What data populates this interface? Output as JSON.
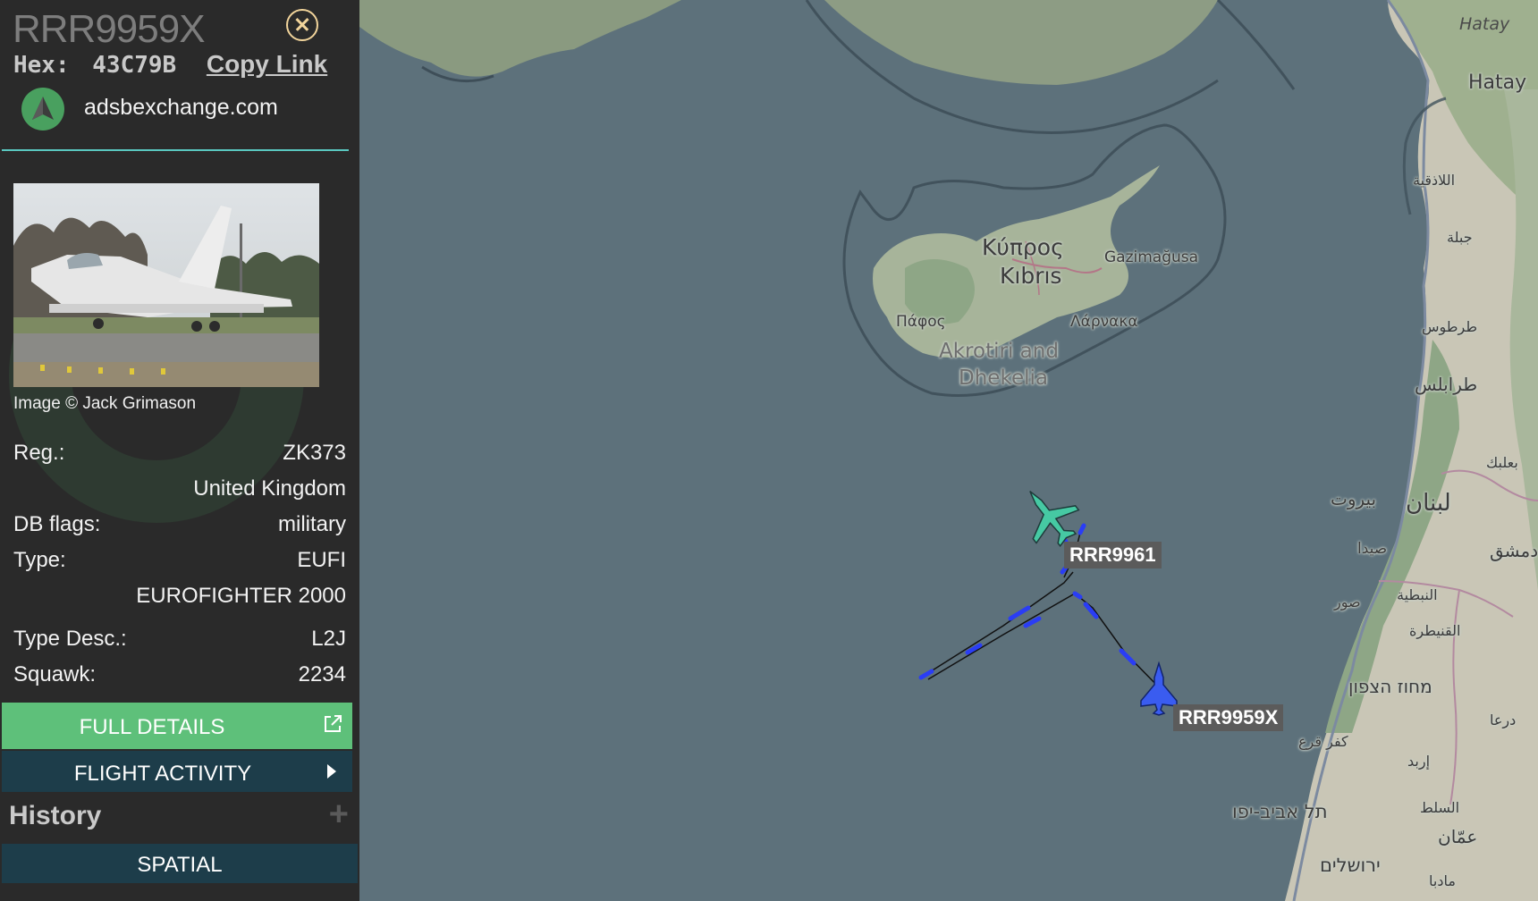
{
  "aircraft": {
    "callsign": "RRR9959X",
    "hex_label": "Hex:",
    "hex": "43C79B",
    "copy_link": "Copy Link",
    "source_site": "adsbexchange.com",
    "photo_credit": "Image © Jack Grimason",
    "fields": [
      {
        "label": "Reg.:",
        "value": "ZK373"
      },
      {
        "label": "",
        "value": "United Kingdom"
      },
      {
        "label": "DB flags:",
        "value": "military"
      },
      {
        "label": "Type:",
        "value": "EUFI"
      },
      {
        "label": "",
        "value": "EUROFIGHTER 2000"
      },
      {
        "label": "Type Desc.:",
        "value": "L2J"
      },
      {
        "label": "Squawk:",
        "value": "2234"
      }
    ]
  },
  "buttons": {
    "full_details": "FULL DETAILS",
    "flight_activity": "FLIGHT ACTIVITY",
    "history": "History",
    "history_expand": "+",
    "spatial": "SPATIAL"
  },
  "map": {
    "place_labels": {
      "hatay_top": "Hatay",
      "hatay": "Hatay",
      "kypros": "Κύπρος",
      "kibris": "Kıbrıs",
      "gazimagusa": "Gazimağusa",
      "pafos": "Πάφος",
      "larnaka": "Λάρνακα",
      "akrotiri": "Akrotiri and",
      "dhekelia": "Dhekelia",
      "latakia": "اللاذقية",
      "jableh": "جبلة",
      "tartus": "طرطوس",
      "tripoli": "طرابلس",
      "baalbek": "بعلبك",
      "beirut": "بيروت",
      "lebanon": "لبنان",
      "sidon": "صيدا",
      "damascus": "دمشق",
      "tyre": "صور",
      "nabatieh": "النبطية",
      "quneitra": "القنيطرة",
      "north_district": "מחוז הצפון",
      "kafr_qara": "كفر قرع",
      "irbid": "إربد",
      "tel_aviv": "תל אביב-יפו",
      "salt": "السلط",
      "amman": "عمّان",
      "jerusalem": "ירושלים",
      "madaba": "مادبا",
      "deraa": "درعا"
    },
    "aircraft_tags": [
      {
        "callsign": "RRR9961",
        "color": "#46c9a3"
      },
      {
        "callsign": "RRR9959X",
        "color": "#3a5cf0"
      }
    ],
    "colors": {
      "sea": "#5d717b",
      "land": "#c6c7b7",
      "green": "#8fa88a",
      "track": "#2a3df5"
    }
  }
}
